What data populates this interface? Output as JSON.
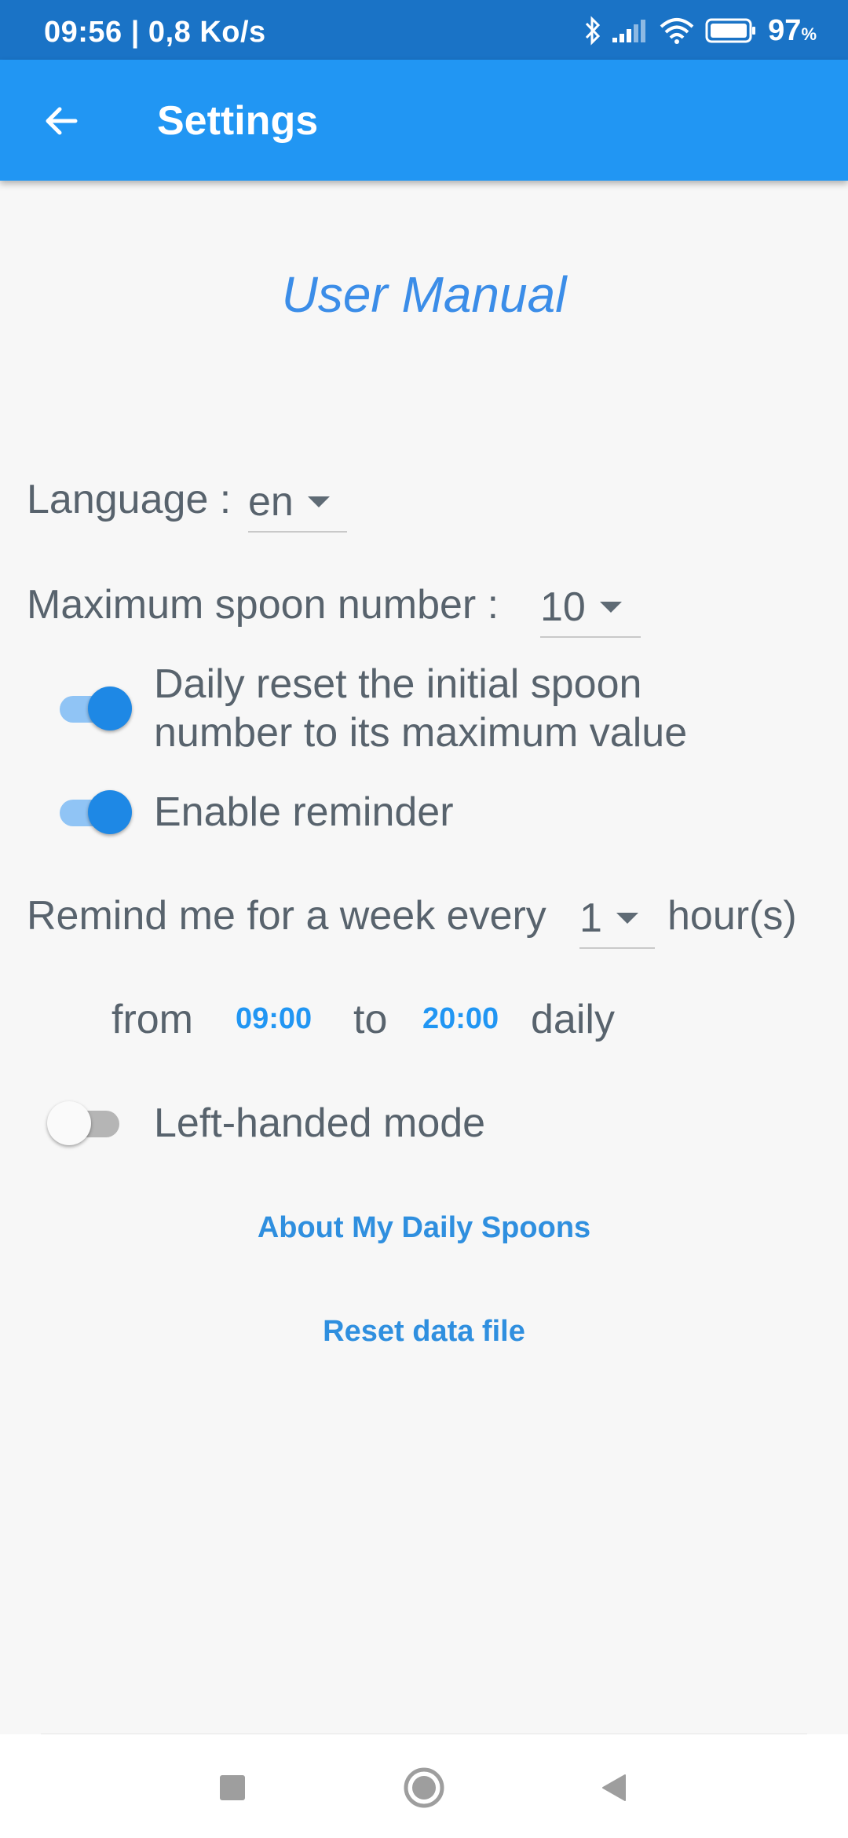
{
  "status_bar": {
    "time_speed": "09:56 | 0,8 Ko/s",
    "battery_percent": "97",
    "battery_unit": "%",
    "icons": [
      "bluetooth-icon",
      "signal-icon",
      "wifi-icon",
      "battery-icon"
    ]
  },
  "app_bar": {
    "title": "Settings",
    "back_icon": "arrow-back-icon",
    "color": "#2196f3"
  },
  "manual": {
    "label": "User Manual"
  },
  "language": {
    "label": "Language :",
    "value": "en"
  },
  "max_spoon": {
    "label": "Maximum spoon number :",
    "value": "10"
  },
  "daily_reset": {
    "line1": "Daily reset the initial spoon",
    "line2": "number to its maximum value",
    "enabled": true
  },
  "reminder": {
    "label": "Enable reminder",
    "enabled": true
  },
  "remind_every": {
    "prefix": "Remind me for a week every",
    "value": "1",
    "suffix": "hour(s)"
  },
  "time_range": {
    "from_label": "from",
    "from_value": "09:00",
    "to_label": "to",
    "to_value": "20:00",
    "suffix": "daily"
  },
  "left_handed": {
    "label": "Left-handed mode",
    "enabled": false
  },
  "about_link": "About My Daily Spoons",
  "reset_link": "Reset data file",
  "nav_bar": {
    "icons": [
      "recents-square-icon",
      "home-circle-icon",
      "back-triangle-icon"
    ]
  }
}
